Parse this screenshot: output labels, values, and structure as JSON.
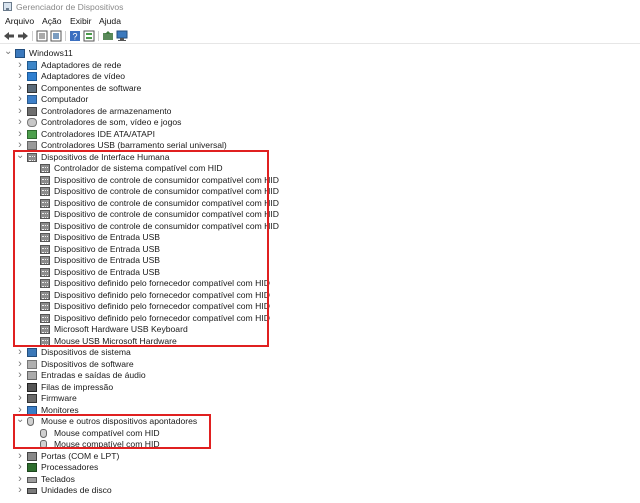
{
  "window": {
    "title": "Gerenciador de Dispositivos"
  },
  "menu": [
    "Arquivo",
    "Ação",
    "Exibir",
    "Ajuda"
  ],
  "toolbar": [
    "back-icon",
    "forward-icon",
    "properties-icon",
    "show-hide-icon",
    "help-icon",
    "list-icon",
    "update-driver-icon",
    "scan-hardware-icon"
  ],
  "tree": {
    "root": "Windows11",
    "nodes": [
      {
        "label": "Adaptadores de rede",
        "expanded": false,
        "icon": "net"
      },
      {
        "label": "Adaptadores de vídeo",
        "expanded": false,
        "icon": "video"
      },
      {
        "label": "Componentes de software",
        "expanded": false,
        "icon": "comp"
      },
      {
        "label": "Computador",
        "expanded": false,
        "icon": "computer"
      },
      {
        "label": "Controladores de armazenamento",
        "expanded": false,
        "icon": "storage"
      },
      {
        "label": "Controladores de som, vídeo e jogos",
        "expanded": false,
        "icon": "sound"
      },
      {
        "label": "Controladores IDE ATA/ATAPI",
        "expanded": false,
        "icon": "ide"
      },
      {
        "label": "Controladores USB (barramento serial universal)",
        "expanded": false,
        "icon": "usb"
      },
      {
        "label": "Dispositivos de Interface Humana",
        "expanded": true,
        "icon": "hid",
        "children": [
          "Controlador de sistema compatível com HID",
          "Dispositivo de controle de consumidor compatível com HID",
          "Dispositivo de controle de consumidor compatível com HID",
          "Dispositivo de controle de consumidor compatível com HID",
          "Dispositivo de controle de consumidor compatível com HID",
          "Dispositivo de controle de consumidor compatível com HID",
          "Dispositivo de Entrada USB",
          "Dispositivo de Entrada USB",
          "Dispositivo de Entrada USB",
          "Dispositivo de Entrada USB",
          "Dispositivo definido pelo fornecedor compatível com HID",
          "Dispositivo definido pelo fornecedor compatível com HID",
          "Dispositivo definido pelo fornecedor compatível com HID",
          "Dispositivo definido pelo fornecedor compatível com HID",
          "Microsoft Hardware USB Keyboard",
          "Mouse USB Microsoft Hardware"
        ]
      },
      {
        "label": "Dispositivos de sistema",
        "expanded": false,
        "icon": "sysdev"
      },
      {
        "label": "Dispositivos de software",
        "expanded": false,
        "icon": "soft"
      },
      {
        "label": "Entradas e saídas de áudio",
        "expanded": false,
        "icon": "audio"
      },
      {
        "label": "Filas de impressão",
        "expanded": false,
        "icon": "print"
      },
      {
        "label": "Firmware",
        "expanded": false,
        "icon": "firm"
      },
      {
        "label": "Monitores",
        "expanded": false,
        "icon": "monitor"
      },
      {
        "label": "Mouse e outros dispositivos apontadores",
        "expanded": true,
        "icon": "mouse",
        "children": [
          "Mouse compatível com HID",
          "Mouse compatível com HID"
        ]
      },
      {
        "label": "Portas (COM e LPT)",
        "expanded": false,
        "icon": "ports"
      },
      {
        "label": "Processadores",
        "expanded": false,
        "icon": "proc"
      },
      {
        "label": "Teclados",
        "expanded": false,
        "icon": "kbd"
      },
      {
        "label": "Unidades de disco",
        "expanded": false,
        "icon": "disk"
      }
    ]
  },
  "colors": {
    "highlight": "#e02020",
    "accent": "#2f7fd0"
  }
}
